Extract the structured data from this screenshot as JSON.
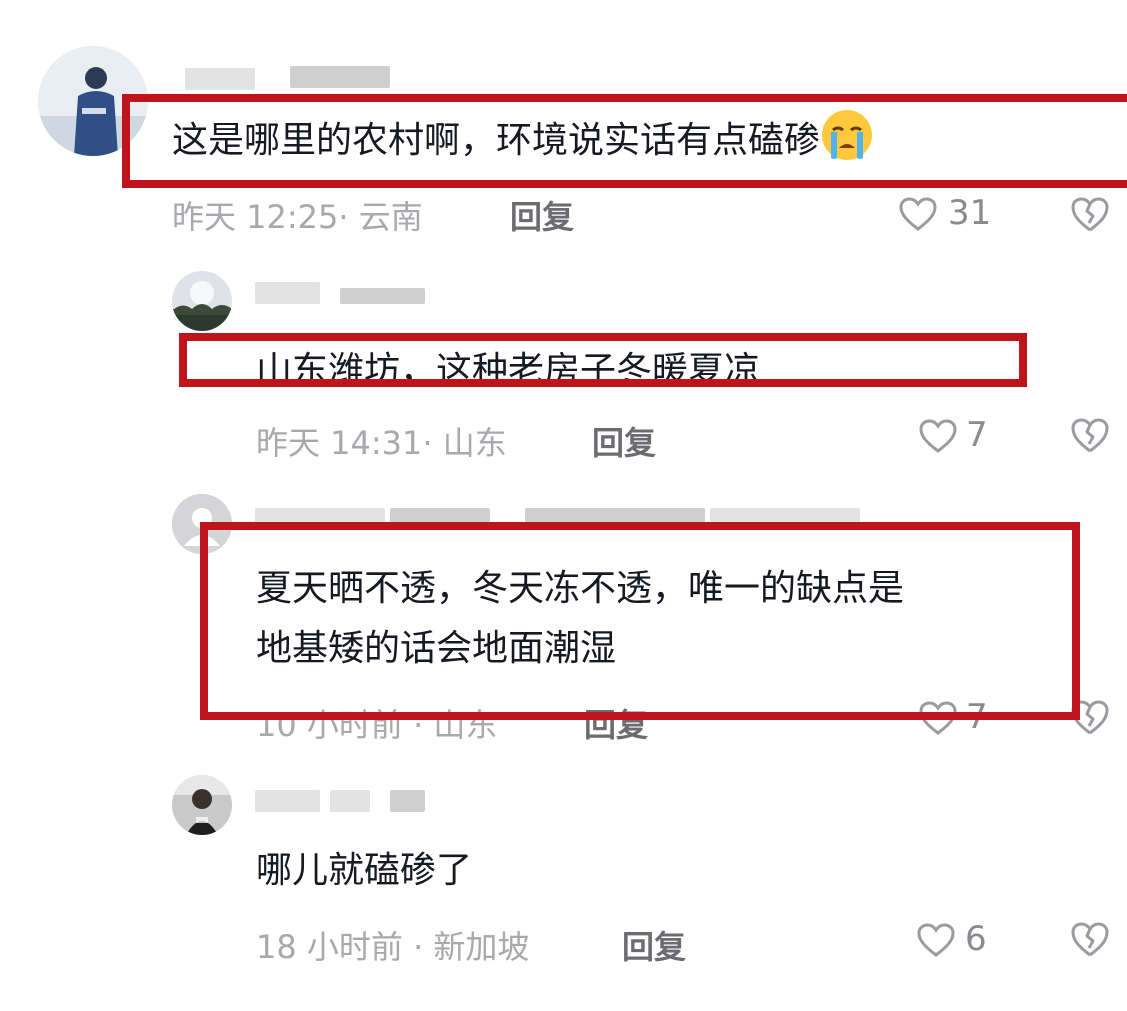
{
  "comments": [
    {
      "text": "这是哪里的农村啊，环境说实话有点磕碜",
      "emoji_icon": "loudly-crying-face-icon",
      "meta": "昨天 12:25· 云南",
      "reply_label": "回复",
      "likes": "31"
    },
    {
      "text": "山东潍坊，这种老房子冬暖夏凉",
      "meta": "昨天 14:31· 山东",
      "reply_label": "回复",
      "likes": "7"
    },
    {
      "text_line1": "夏天晒不透，冬天冻不透，唯一的缺点是",
      "text_line2": "地基矮的话会地面潮湿",
      "meta": "10 小时前 · 山东",
      "reply_label": "回复",
      "likes": "7"
    },
    {
      "text": "哪儿就磕碜了",
      "meta": "18 小时前 · 新加坡",
      "reply_label": "回复",
      "likes": "6"
    }
  ],
  "colors": {
    "highlight": "#c0141c",
    "text": "#161823",
    "meta": "#a8a8ad"
  }
}
